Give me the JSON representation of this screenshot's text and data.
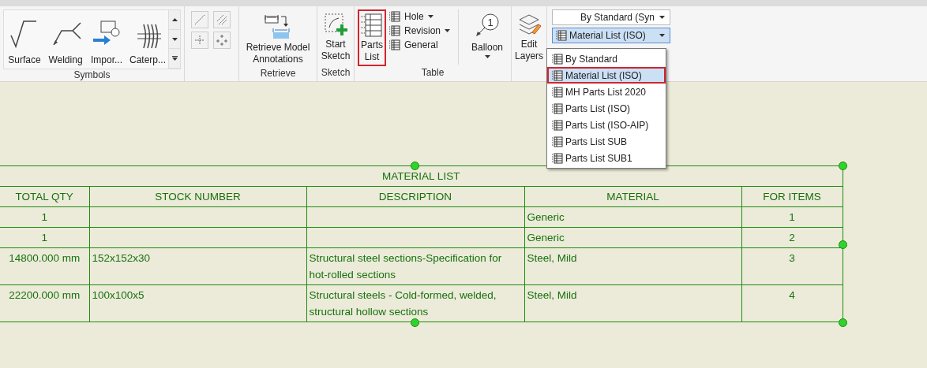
{
  "ribbon": {
    "symbols": {
      "label": "Symbols",
      "items": [
        "Surface",
        "Welding",
        "Impor...",
        "Caterp..."
      ]
    },
    "retrieve": {
      "label": "Retrieve",
      "button": "Retrieve Model Annotations"
    },
    "sketch": {
      "label": "Sketch",
      "button": "Start Sketch"
    },
    "table_group": {
      "label": "Table",
      "parts_list": {
        "label": "Parts List",
        "annotated": true
      },
      "small_buttons": [
        {
          "label": "Hole",
          "dropdown": true
        },
        {
          "label": "Revision",
          "dropdown": true
        },
        {
          "label": "General",
          "dropdown": false
        }
      ],
      "balloon": "Balloon",
      "balloon_number": "1"
    },
    "edit_layers": "Edit Layers",
    "styles": {
      "dimension_style": "By Standard (Syn",
      "parts_list_style": "Material List (ISO)",
      "expanded": true,
      "options": [
        {
          "label": "By Standard",
          "selected": false,
          "annotated": false
        },
        {
          "label": "Material List (ISO)",
          "selected": true,
          "annotated": true
        },
        {
          "label": "MH Parts List 2020",
          "selected": false,
          "annotated": false
        },
        {
          "label": "Parts List (ISO)",
          "selected": false,
          "annotated": false
        },
        {
          "label": "Parts List (ISO-AIP)",
          "selected": false,
          "annotated": false
        },
        {
          "label": "Parts List SUB",
          "selected": false,
          "annotated": false
        },
        {
          "label": "Parts List SUB1",
          "selected": false,
          "annotated": false
        }
      ]
    }
  },
  "table": {
    "title": "MATERIAL LIST",
    "columns": [
      "TOTAL QTY",
      "STOCK NUMBER",
      "DESCRIPTION",
      "MATERIAL",
      "FOR ITEMS"
    ],
    "rows": [
      {
        "total_qty": "1",
        "material": "Generic",
        "for_items": "1"
      },
      {
        "total_qty": "1",
        "material": "Generic",
        "for_items": "2"
      },
      {
        "total_qty": "14800.000 mm",
        "stock_number": "152x152x30",
        "description": "Structural steel sections-Specification for hot-rolled sections",
        "material": "Steel, Mild",
        "for_items": "3"
      },
      {
        "total_qty": "22200.000 mm",
        "stock_number": "100x100x5",
        "description": "Structural steels - Cold-formed, welded, structural hollow sections",
        "material": "Steel, Mild",
        "for_items": "4"
      }
    ]
  }
}
